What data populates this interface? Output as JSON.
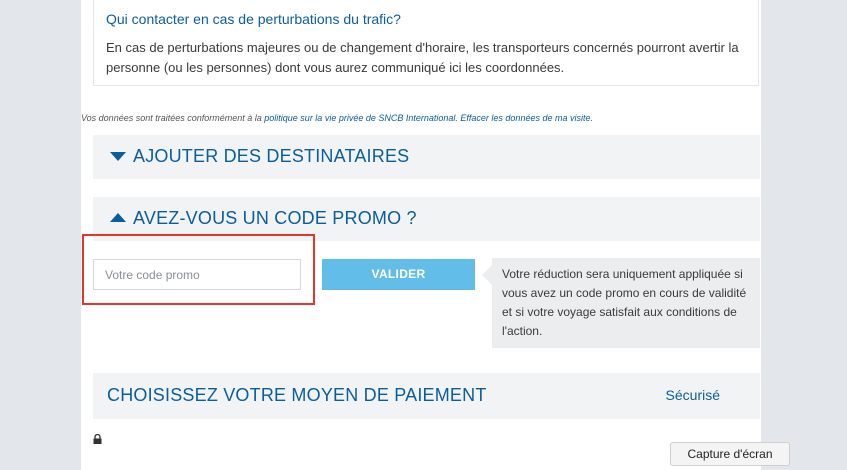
{
  "contact": {
    "title": "Qui contacter en cas de perturbations du trafic?",
    "text": "En cas de perturbations majeures ou de changement d'horaire, les transporteurs concernés pourront avertir la personne (ou les personnes) dont vous aurez communiqué ici les coordonnées."
  },
  "privacy": {
    "prefix": "Vos données sont traitées conformément à la ",
    "policy_link": "politique sur la vie privée de SNCB International",
    "separator": ". ",
    "clear_link": "Effacer les données de ma visite",
    "suffix": "."
  },
  "recipients": {
    "label": "AJOUTER DES DESTINATAIRES",
    "icon": "triangle-down-icon"
  },
  "promo": {
    "label": "AVEZ-VOUS UN CODE PROMO ?",
    "icon": "triangle-up-icon",
    "input_placeholder": "Votre code promo",
    "input_value": "",
    "validate_label": "VALIDER",
    "tooltip": "Votre réduction sera uniquement appliquée si vous avez un code promo en cours de validité et si votre voyage satisfait aux conditions de l'action."
  },
  "payment": {
    "label": "CHOISISSEZ VOTRE MOYEN DE PAIEMENT",
    "secure_label": "Sécurisé",
    "icon": "lock-icon"
  },
  "overlay": {
    "capture_label": "Capture d'écran"
  },
  "colors": {
    "accent": "#0a5e9c",
    "button": "#63bde9",
    "highlight": "#e0382a",
    "bar_bg": "#f1f3f4"
  }
}
